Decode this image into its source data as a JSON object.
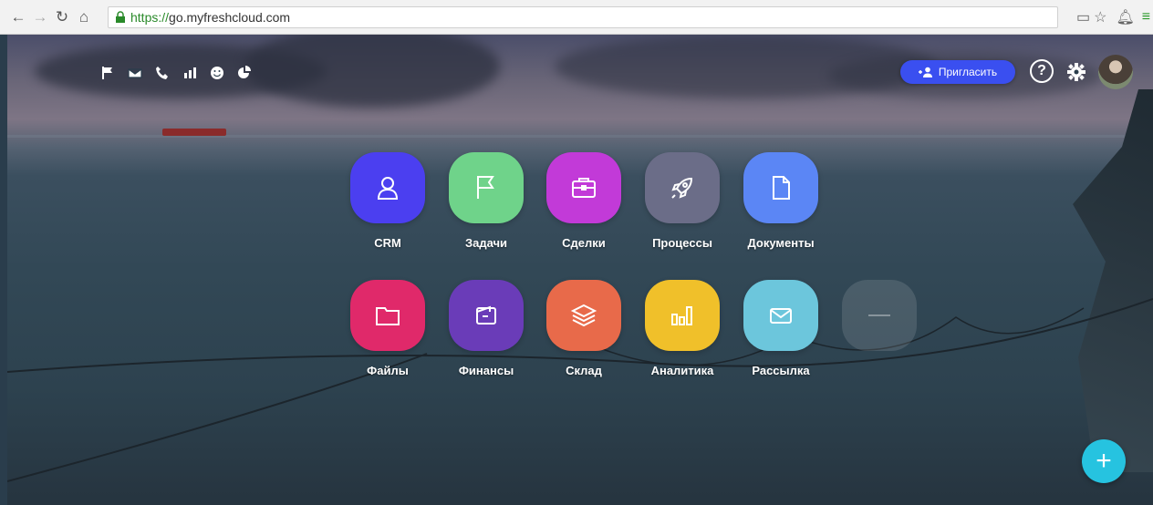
{
  "browser": {
    "url_protocol": "https://",
    "url_host": "go.myfreshcloud.com"
  },
  "toolbar": {
    "invite_label": "Пригласить",
    "help_label": "?"
  },
  "apps": [
    {
      "label": "CRM",
      "color": "#4b3ff0"
    },
    {
      "label": "Задачи",
      "color": "#6fd38a"
    },
    {
      "label": "Сделки",
      "color": "#c23ad8"
    },
    {
      "label": "Процессы",
      "color": "#6b6d88"
    },
    {
      "label": "Документы",
      "color": "#5b86f5"
    },
    {
      "label": "Файлы",
      "color": "#e0296a"
    },
    {
      "label": "Финансы",
      "color": "#6a3cb8"
    },
    {
      "label": "Склад",
      "color": "#e86a4a"
    },
    {
      "label": "Аналитика",
      "color": "#f0c02a"
    },
    {
      "label": "Рассылка",
      "color": "#6cc6dc"
    }
  ],
  "fab_label": "+"
}
